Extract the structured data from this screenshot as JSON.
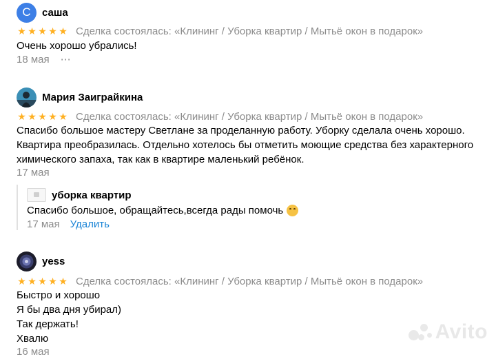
{
  "reviews": [
    {
      "author": "саша",
      "avatar_letter": "С",
      "avatar_color": "#3d7fe6",
      "rating": 5,
      "deal": "Сделка состоялась: «Клининг / Уборка квартир / Мытьё окон в подарок»",
      "text": [
        "Очень хорошо убрались!"
      ],
      "date": "18 мая",
      "more": "⋯"
    },
    {
      "author": "Мария Заиграйкина",
      "avatar": "photo",
      "rating": 5,
      "deal": "Сделка состоялась: «Клининг / Уборка квартир / Мытьё окон в подарок»",
      "text": [
        "Спасибо большое мастеру Светлане за проделанную работу. Уборку сделала очень хорошо.",
        "Квартира преобразилась. Отдельно хотелось бы отметить моющие средства без характерного",
        "химического запаха, так как в квартире маленький ребёнок."
      ],
      "date": "17 мая",
      "reply": {
        "author": "уборка квартир",
        "text": "Спасибо большое, обращайтесь,всегда рады помочь",
        "emoji": "hugging-face",
        "date": "17 мая",
        "action": "Удалить"
      }
    },
    {
      "author": "yess",
      "avatar": "photo",
      "rating": 5,
      "deal": "Сделка состоялась: «Клининг / Уборка квартир / Мытьё окон в подарок»",
      "text": [
        "Быстро и хорошо",
        "Я бы два дня убирал)",
        "Так держать!",
        "Хвалю"
      ],
      "date": "16 мая"
    }
  ],
  "star_glyph": "★",
  "star_color": "#ffb021",
  "link_color": "#1a84d6",
  "watermark": "Avito"
}
